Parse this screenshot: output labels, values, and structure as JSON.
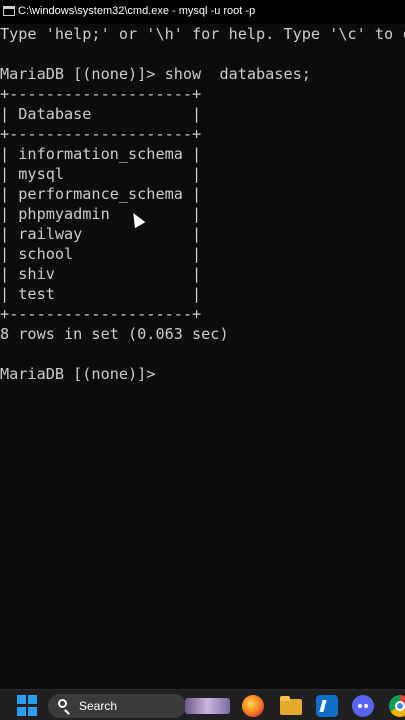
{
  "window": {
    "title": "C:\\windows\\system32\\cmd.exe - mysql  -u root -p"
  },
  "console": {
    "lines": [
      "Type 'help;' or '\\h' for help. Type '\\c' to clear the current input statement.",
      "",
      "MariaDB [(none)]> show  databases;",
      "+--------------------+",
      "| Database           |",
      "+--------------------+",
      "| information_schema |",
      "| mysql              |",
      "| performance_schema |",
      "| phpmyadmin         |",
      "| railway            |",
      "| school             |",
      "| shiv               |",
      "| test               |",
      "+--------------------+",
      "8 rows in set (0.063 sec)",
      "",
      "MariaDB [(none)]> "
    ]
  },
  "taskbar": {
    "search_label": "Search",
    "icons": [
      "windows-start-icon",
      "search-icon",
      "widget-art-icon",
      "firefox-icon",
      "file-explorer-icon",
      "vscode-icon",
      "discord-icon",
      "chrome-icon"
    ]
  },
  "colors": {
    "console_bg": "#0c0c0c",
    "console_text": "#cccccc",
    "taskbar_bg": "#202020",
    "accent": "#2aa0f5"
  }
}
